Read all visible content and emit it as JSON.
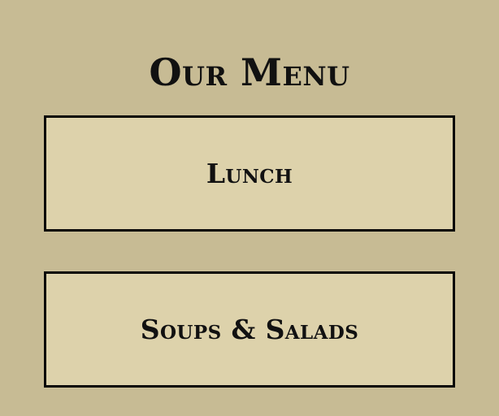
{
  "page": {
    "title": "Our Menu"
  },
  "menu": {
    "items": [
      {
        "label": "Lunch"
      },
      {
        "label": "Soups & Salads"
      }
    ]
  },
  "colors": {
    "background": "#c7bb94",
    "card_fill": "#ddd2ab",
    "border": "#050505",
    "text": "#111111"
  }
}
